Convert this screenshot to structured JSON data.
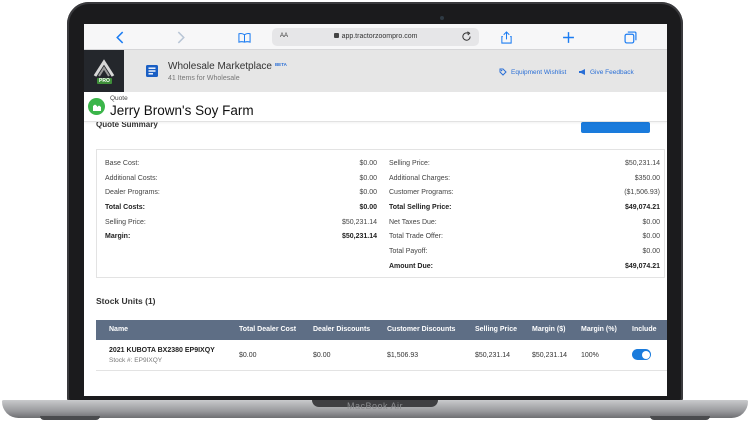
{
  "device": {
    "model_label": "MacBook Air"
  },
  "browser": {
    "text_size_label": "AA",
    "url": "app.tractorzoompro.com"
  },
  "header": {
    "logo_badge": "PRO",
    "marketplace_title": "Wholesale Marketplace",
    "beta_badge": "BETA",
    "items_count": "41 Items for Wholesale",
    "equipment_wishlist": "Equipment Wishlist",
    "give_feedback": "Give Feedback"
  },
  "quote": {
    "label": "Quote",
    "customer_name": "Jerry Brown's Soy Farm",
    "section_title_partial": "Quote Summary"
  },
  "summary": {
    "left": [
      {
        "label": "Base Cost:",
        "value": "$0.00",
        "bold": false
      },
      {
        "label": "Additional Costs:",
        "value": "$0.00",
        "bold": false
      },
      {
        "label": "Dealer Programs:",
        "value": "$0.00",
        "bold": false
      },
      {
        "label": "Total Costs:",
        "value": "$0.00",
        "bold": true
      },
      {
        "label": "Selling Price:",
        "value": "$50,231.14",
        "bold": false
      },
      {
        "label": "Margin:",
        "value": "$50,231.14",
        "bold": true
      }
    ],
    "right": [
      {
        "label": "Selling Price:",
        "value": "$50,231.14",
        "bold": false
      },
      {
        "label": "Additional Charges:",
        "value": "$350.00",
        "bold": false
      },
      {
        "label": "Customer Programs:",
        "value": "($1,506.93)",
        "bold": false
      },
      {
        "label": "Total Selling Price:",
        "value": "$49,074.21",
        "bold": true
      },
      {
        "label": "Net Taxes Due:",
        "value": "$0.00",
        "bold": false
      },
      {
        "label": "Total Trade Offer:",
        "value": "$0.00",
        "bold": false
      },
      {
        "label": "Total Payoff:",
        "value": "$0.00",
        "bold": false
      },
      {
        "label": "Amount Due:",
        "value": "$49,074.21",
        "bold": true
      }
    ]
  },
  "stock_units": {
    "title": "Stock Units (1)",
    "columns": [
      "Name",
      "Total Dealer Cost",
      "Dealer Discounts",
      "Customer Discounts",
      "Selling Price",
      "Margin ($)",
      "Margin (%)",
      "Include"
    ],
    "rows": [
      {
        "name": "2021 KUBOTA BX2380 EP9IXQY",
        "stock": "Stock #: EP9IXQY",
        "total_dealer_cost": "$0.00",
        "dealer_discounts": "$0.00",
        "customer_discounts": "$1,506.93",
        "selling_price": "$50,231.14",
        "margin_dollars": "$50,231.14",
        "margin_percent": "100%",
        "include": true
      }
    ]
  },
  "colors": {
    "accent": "#1a7bdc",
    "table_header": "#5e6e85",
    "quote_icon": "#3bb54a",
    "app_header": "#e6e6e6"
  }
}
